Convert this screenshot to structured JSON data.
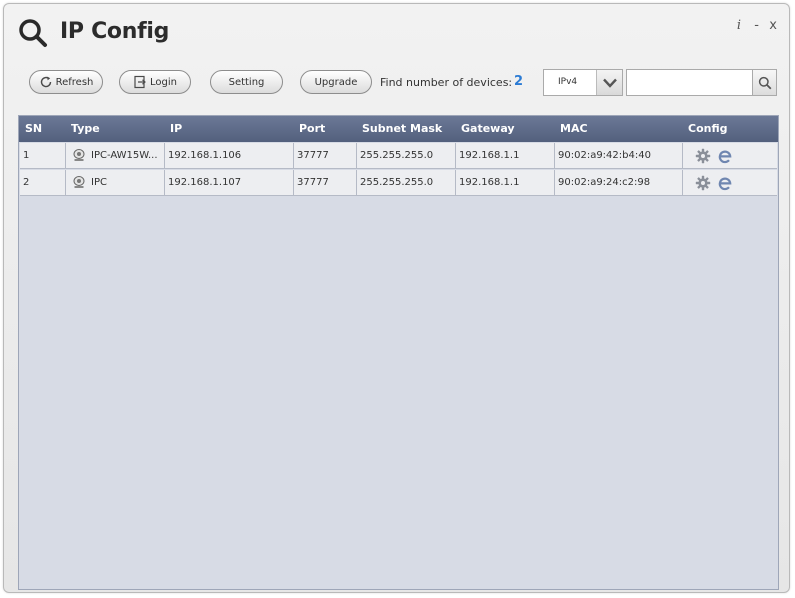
{
  "window": {
    "title": "IP Config",
    "controls": {
      "info": "i",
      "minimize": "-",
      "close": "x"
    }
  },
  "toolbar": {
    "refresh_label": "Refresh",
    "login_label": "Login",
    "setting_label": "Setting",
    "upgrade_label": "Upgrade",
    "find_label": "Find number of devices:",
    "device_count": "2",
    "ip_version": "IPv4",
    "search_value": ""
  },
  "table": {
    "headers": {
      "sn": "SN",
      "type": "Type",
      "ip": "IP",
      "port": "Port",
      "mask": "Subnet Mask",
      "gateway": "Gateway",
      "mac": "MAC",
      "config": "Config"
    },
    "rows": [
      {
        "sn": "1",
        "type": "IPC-AW15W...",
        "ip": "192.168.1.106",
        "port": "37777",
        "mask": "255.255.255.0",
        "gateway": "192.168.1.1",
        "mac": "90:02:a9:42:b4:40"
      },
      {
        "sn": "2",
        "type": "IPC",
        "ip": "192.168.1.107",
        "port": "37777",
        "mask": "255.255.255.0",
        "gateway": "192.168.1.1",
        "mac": "90:02:a9:24:c2:98"
      }
    ]
  },
  "icons": {
    "logo": "search-icon",
    "refresh": "refresh-icon",
    "login": "login-icon",
    "dropdown": "chevron-down-icon",
    "search": "search-icon",
    "device": "camera-icon",
    "config": "gear-icon",
    "web": "browser-icon"
  },
  "colors": {
    "header_bg": "#5b6886",
    "count_text": "#2b7bd4",
    "grid_bg": "#d7dbe5"
  }
}
